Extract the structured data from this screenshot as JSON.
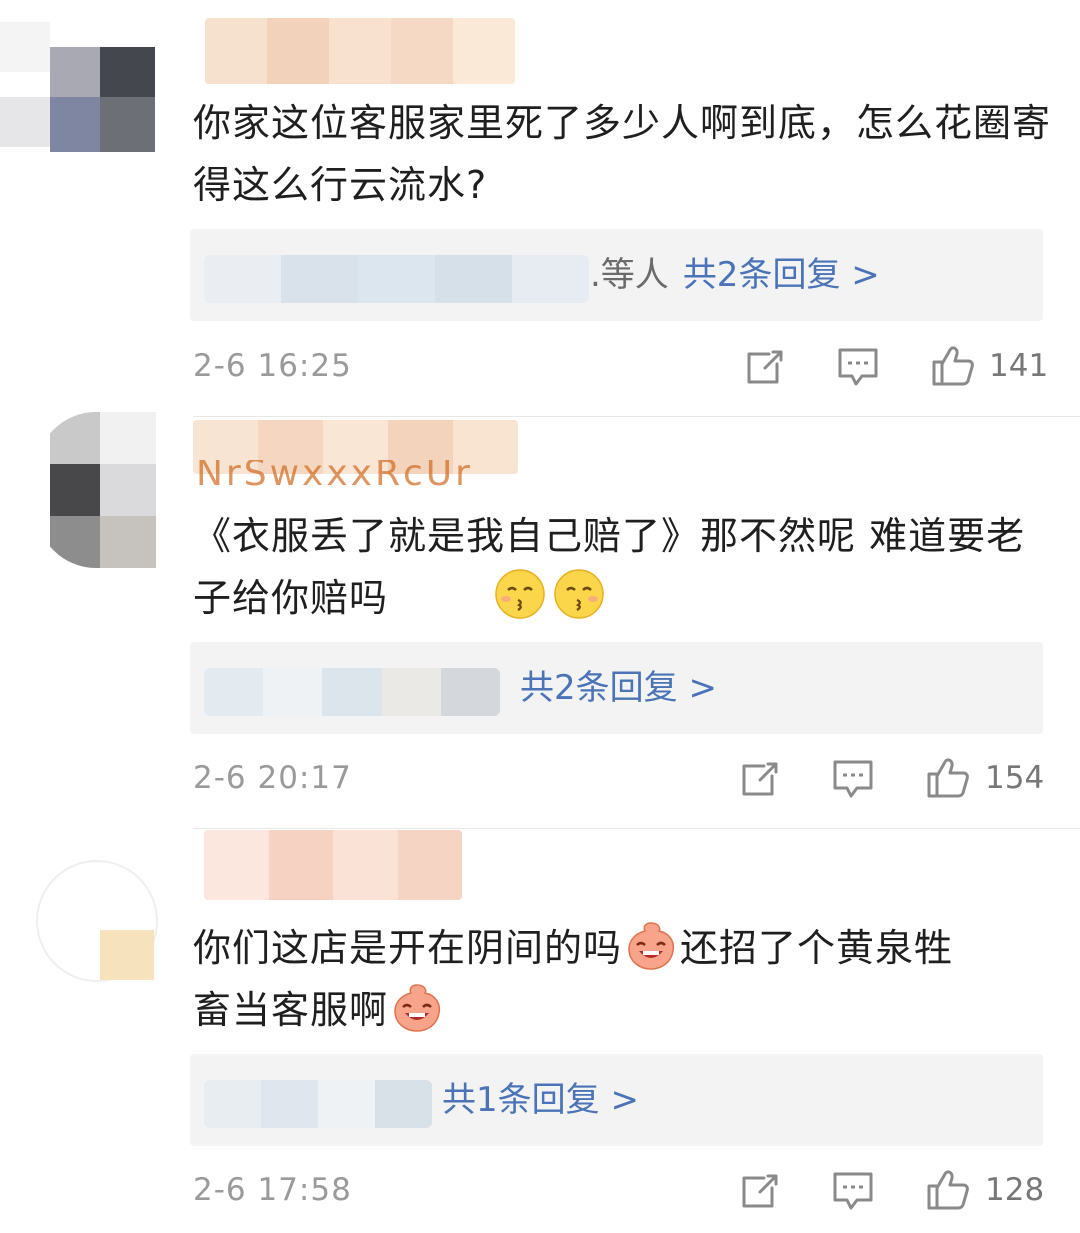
{
  "comments": [
    {
      "text": "你家这位客服家里死了多少人啊到底，怎么花圈寄得这么行云流水?",
      "reply_others": ".等人",
      "reply_count": "共2条回复 >",
      "time": "2-6 16:25",
      "likes": "141"
    },
    {
      "username_partial": "NrSwxxxRcUr",
      "text": "《衣服丢了就是我自己赔了》那不然呢 难道要老子给你赔吗",
      "emojis": [
        "kiss-emoji",
        "kiss-emoji"
      ],
      "reply_count": "共2条回复 >",
      "time": "2-6 20:17",
      "likes": "154"
    },
    {
      "text_line1": "你们这店是开在阴间的吗",
      "text_line1b": "还招了个黄泉牲",
      "text_line2": "畜当客服啊",
      "emojis": [
        "laughing-emoji",
        "laughing-emoji"
      ],
      "reply_count": "共1条回复 >",
      "time": "2-6 17:58",
      "likes": "128"
    }
  ],
  "colors": {
    "reply_link": "#4a73b8",
    "meta_text": "#9a9a9a",
    "reply_bg": "#f3f3f3"
  }
}
